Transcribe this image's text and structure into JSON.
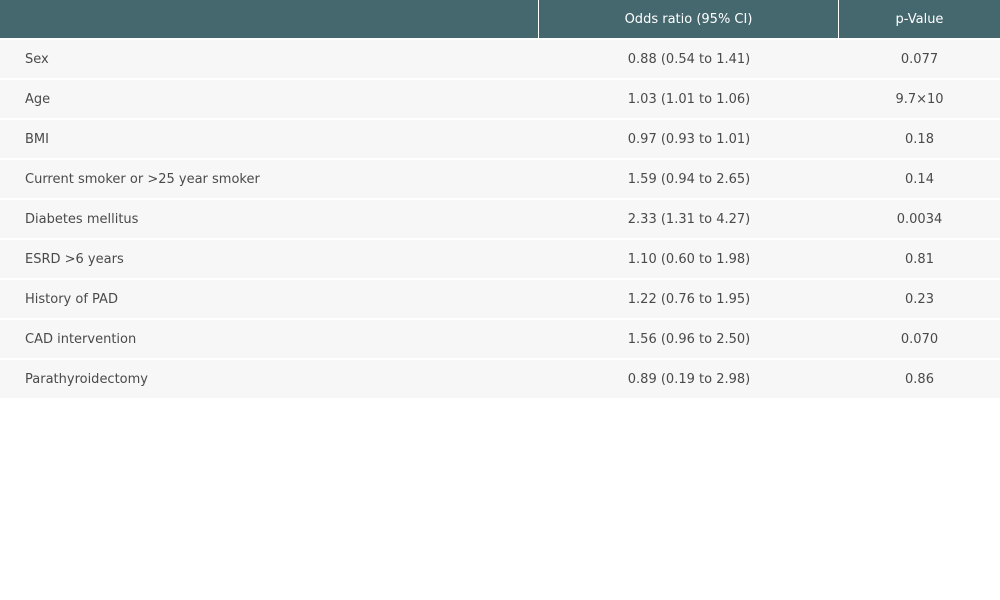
{
  "table": {
    "headers": [
      "",
      "Odds ratio (95% CI)",
      "p-Value"
    ],
    "rows": [
      {
        "label": "Sex",
        "odds": "0.88 (0.54 to 1.41)",
        "p": "0.077"
      },
      {
        "label": "Age",
        "odds": "1.03 (1.01 to 1.06)",
        "p": "9.7×10"
      },
      {
        "label": "BMI",
        "odds": "0.97 (0.93 to 1.01)",
        "p": "0.18"
      },
      {
        "label": "Current smoker or >25 year smoker",
        "odds": "1.59 (0.94 to 2.65)",
        "p": "0.14"
      },
      {
        "label": "Diabetes mellitus",
        "odds": "2.33 (1.31 to 4.27)",
        "p": "0.0034"
      },
      {
        "label": "ESRD >6 years",
        "odds": "1.10 (0.60 to 1.98)",
        "p": "0.81"
      },
      {
        "label": "History of PAD",
        "odds": "1.22 (0.76 to 1.95)",
        "p": "0.23"
      },
      {
        "label": "CAD intervention",
        "odds": "1.56 (0.96 to 2.50)",
        "p": "0.070"
      },
      {
        "label": "Parathyroidectomy",
        "odds": "0.89 (0.19 to 2.98)",
        "p": "0.86"
      }
    ]
  },
  "colors": {
    "header_bg": "#45686f",
    "row_bg": "#f7f7f7",
    "text": "#4a4a4a"
  }
}
